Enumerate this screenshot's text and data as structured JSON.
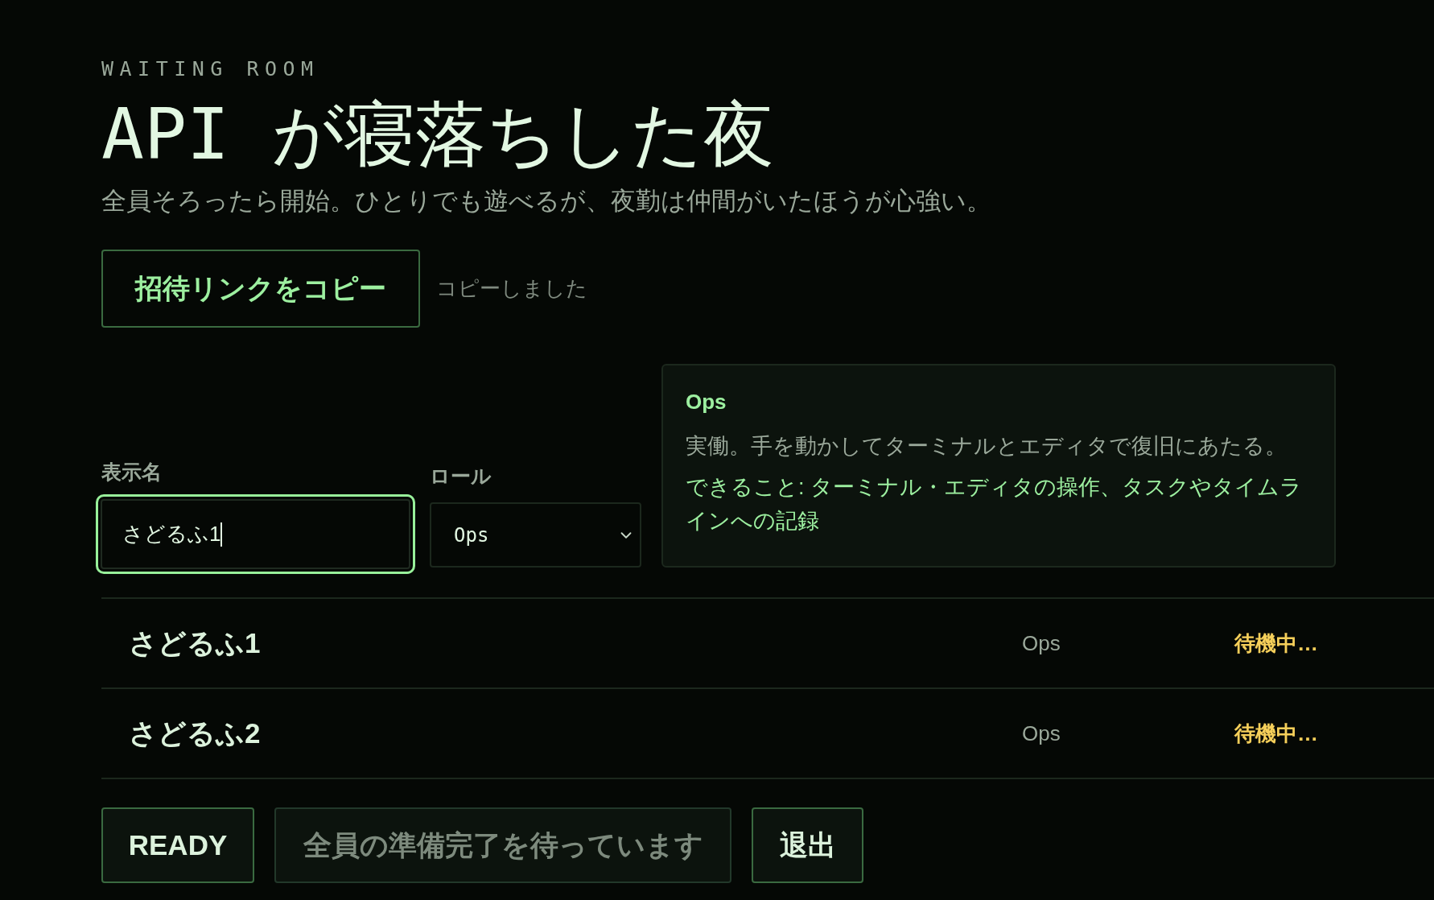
{
  "header": {
    "eyebrow": "WAITING ROOM",
    "title": "API が寝落ちした夜",
    "subtitle": "全員そろったら開始。ひとりでも遊べるが、夜勤は仲間がいたほうが心強い。"
  },
  "invite": {
    "button": "招待リンクをコピー",
    "status": "コピーしました"
  },
  "form": {
    "name_field": {
      "label": "表示名",
      "value": "さどるふ1",
      "focused": true
    },
    "role_select": {
      "label": "ロール",
      "value": "Ops"
    }
  },
  "role_card": {
    "title": "Ops",
    "description": "実働。手を動かしてターミナルとエディタで復旧にあたる。",
    "abilities": "できること: ターミナル・エディタの操作、タスクやタイムラインへの記録"
  },
  "players": [
    {
      "name": "さどるふ1",
      "role": "Ops",
      "status": "待機中…",
      "ready": false
    },
    {
      "name": "さどるふ2",
      "role": "Ops",
      "status": "待機中…",
      "ready": false
    }
  ],
  "actions": [
    {
      "label": "READY",
      "disabled": false
    },
    {
      "label": "全員の準備完了を待っています",
      "disabled": true
    },
    {
      "label": "退出",
      "disabled": false
    }
  ]
}
